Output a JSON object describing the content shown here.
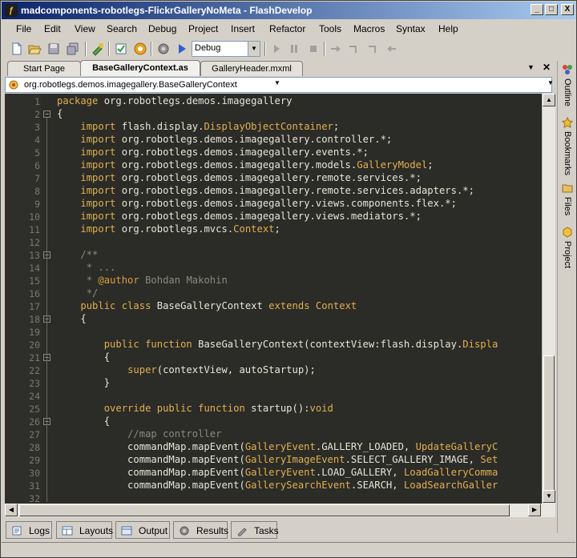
{
  "window": {
    "title": "madcomponents-robotlegs-FlickrGalleryNoMeta - FlashDevelop",
    "min": "_",
    "max": "□",
    "close": "X"
  },
  "menu": [
    "File",
    "Edit",
    "View",
    "Search",
    "Debug",
    "Project",
    "Insert",
    "Refactor",
    "Tools",
    "Macros",
    "Syntax",
    "Help"
  ],
  "toolbar": {
    "config": "Debug",
    "buttons": [
      "new-file",
      "open-file",
      "save",
      "save-all",
      "build",
      "check-syntax",
      "run",
      "settings",
      "play",
      "start-debug",
      "pause",
      "stop",
      "step-over",
      "step-in",
      "step-out",
      "step-back"
    ]
  },
  "tabs": [
    {
      "label": "Start Page",
      "active": false
    },
    {
      "label": "BaseGalleryContext.as",
      "active": true
    },
    {
      "label": "GalleryHeader.mxml",
      "active": false
    }
  ],
  "classpath": "org.robotlegs.demos.imagegallery.BaseGalleryContext",
  "editor": {
    "lines": [
      {
        "n": "1",
        "t": [
          [
            "kw",
            "package"
          ],
          [
            "p",
            " org.robotlegs.demos.imagegallery"
          ]
        ]
      },
      {
        "n": "2",
        "t": [
          [
            "p",
            "{"
          ]
        ]
      },
      {
        "n": "3",
        "t": [
          [
            "p",
            "    "
          ],
          [
            "kw",
            "import"
          ],
          [
            "p",
            " flash.display."
          ],
          [
            "ty",
            "DisplayObjectContainer"
          ],
          [
            "p",
            ";"
          ]
        ]
      },
      {
        "n": "4",
        "t": [
          [
            "p",
            "    "
          ],
          [
            "kw",
            "import"
          ],
          [
            "p",
            " org.robotlegs.demos.imagegallery.controller.*;"
          ]
        ]
      },
      {
        "n": "5",
        "t": [
          [
            "p",
            "    "
          ],
          [
            "kw",
            "import"
          ],
          [
            "p",
            " org.robotlegs.demos.imagegallery.events.*;"
          ]
        ]
      },
      {
        "n": "6",
        "t": [
          [
            "p",
            "    "
          ],
          [
            "kw",
            "import"
          ],
          [
            "p",
            " org.robotlegs.demos.imagegallery.models."
          ],
          [
            "ty",
            "GalleryModel"
          ],
          [
            "p",
            ";"
          ]
        ]
      },
      {
        "n": "7",
        "t": [
          [
            "p",
            "    "
          ],
          [
            "kw",
            "import"
          ],
          [
            "p",
            " org.robotlegs.demos.imagegallery.remote.services.*;"
          ]
        ]
      },
      {
        "n": "8",
        "t": [
          [
            "p",
            "    "
          ],
          [
            "kw",
            "import"
          ],
          [
            "p",
            " org.robotlegs.demos.imagegallery.remote.services.adapters.*;"
          ]
        ]
      },
      {
        "n": "9",
        "t": [
          [
            "p",
            "    "
          ],
          [
            "kw",
            "import"
          ],
          [
            "p",
            " org.robotlegs.demos.imagegallery.views.components.flex.*;"
          ]
        ]
      },
      {
        "n": "10",
        "t": [
          [
            "p",
            "    "
          ],
          [
            "kw",
            "import"
          ],
          [
            "p",
            " org.robotlegs.demos.imagegallery.views.mediators.*;"
          ]
        ]
      },
      {
        "n": "11",
        "t": [
          [
            "p",
            "    "
          ],
          [
            "kw",
            "import"
          ],
          [
            "p",
            " org.robotlegs.mvcs."
          ],
          [
            "ty",
            "Context"
          ],
          [
            "p",
            ";"
          ]
        ]
      },
      {
        "n": "12",
        "t": []
      },
      {
        "n": "13",
        "t": [
          [
            "p",
            "    "
          ],
          [
            "cm",
            "/**"
          ]
        ]
      },
      {
        "n": "14",
        "t": [
          [
            "p",
            "    "
          ],
          [
            "cm",
            " * ..."
          ]
        ]
      },
      {
        "n": "15",
        "t": [
          [
            "p",
            "    "
          ],
          [
            "cm",
            " * "
          ],
          [
            "doc",
            "@author"
          ],
          [
            "cm",
            " Bohdan Makohin"
          ]
        ]
      },
      {
        "n": "16",
        "t": [
          [
            "p",
            "    "
          ],
          [
            "cm",
            " */"
          ]
        ]
      },
      {
        "n": "17",
        "t": [
          [
            "p",
            "    "
          ],
          [
            "kw",
            "public class"
          ],
          [
            "p",
            " BaseGalleryContext "
          ],
          [
            "kw",
            "extends"
          ],
          [
            "p",
            " "
          ],
          [
            "ty",
            "Context"
          ]
        ]
      },
      {
        "n": "18",
        "t": [
          [
            "p",
            "    {"
          ]
        ]
      },
      {
        "n": "19",
        "t": []
      },
      {
        "n": "20",
        "t": [
          [
            "p",
            "        "
          ],
          [
            "kw",
            "public function"
          ],
          [
            "p",
            " BaseGalleryContext(contextView:flash.display."
          ],
          [
            "ty",
            "Displa"
          ]
        ]
      },
      {
        "n": "21",
        "t": [
          [
            "p",
            "        {"
          ]
        ]
      },
      {
        "n": "22",
        "t": [
          [
            "p",
            "            "
          ],
          [
            "kw",
            "super"
          ],
          [
            "p",
            "(contextView, autoStartup);"
          ]
        ]
      },
      {
        "n": "23",
        "t": [
          [
            "p",
            "        }"
          ]
        ]
      },
      {
        "n": "24",
        "t": []
      },
      {
        "n": "25",
        "t": [
          [
            "p",
            "        "
          ],
          [
            "kw",
            "override public function"
          ],
          [
            "p",
            " startup():"
          ],
          [
            "kw",
            "void"
          ]
        ]
      },
      {
        "n": "26",
        "t": [
          [
            "p",
            "        {"
          ]
        ]
      },
      {
        "n": "27",
        "t": [
          [
            "p",
            "            "
          ],
          [
            "cm",
            "//map controller"
          ]
        ]
      },
      {
        "n": "28",
        "t": [
          [
            "p",
            "            commandMap.mapEvent("
          ],
          [
            "ty",
            "GalleryEvent"
          ],
          [
            "p",
            ".GALLERY_LOADED, "
          ],
          [
            "ty",
            "UpdateGalleryC"
          ]
        ]
      },
      {
        "n": "29",
        "t": [
          [
            "p",
            "            commandMap.mapEvent("
          ],
          [
            "ty",
            "GalleryImageEvent"
          ],
          [
            "p",
            ".SELECT_GALLERY_IMAGE, "
          ],
          [
            "ty",
            "Set"
          ]
        ]
      },
      {
        "n": "30",
        "t": [
          [
            "p",
            "            commandMap.mapEvent("
          ],
          [
            "ty",
            "GalleryEvent"
          ],
          [
            "p",
            ".LOAD_GALLERY, "
          ],
          [
            "ty",
            "LoadGalleryComma"
          ]
        ]
      },
      {
        "n": "31",
        "t": [
          [
            "p",
            "            commandMap.mapEvent("
          ],
          [
            "ty",
            "GallerySearchEvent"
          ],
          [
            "p",
            ".SEARCH, "
          ],
          [
            "ty",
            "LoadSearchGaller"
          ]
        ]
      },
      {
        "n": "32",
        "t": []
      }
    ]
  },
  "side_panels": [
    "Outline",
    "Bookmarks",
    "Files",
    "Project"
  ],
  "bottom_tabs": [
    "Logs",
    "Layouts",
    "Output",
    "Results",
    "Tasks"
  ],
  "colors": {
    "editor_bg": "#2b2b27",
    "keyword": "#e0b050",
    "comment": "#8a8a80",
    "text": "#e6e6d8"
  }
}
